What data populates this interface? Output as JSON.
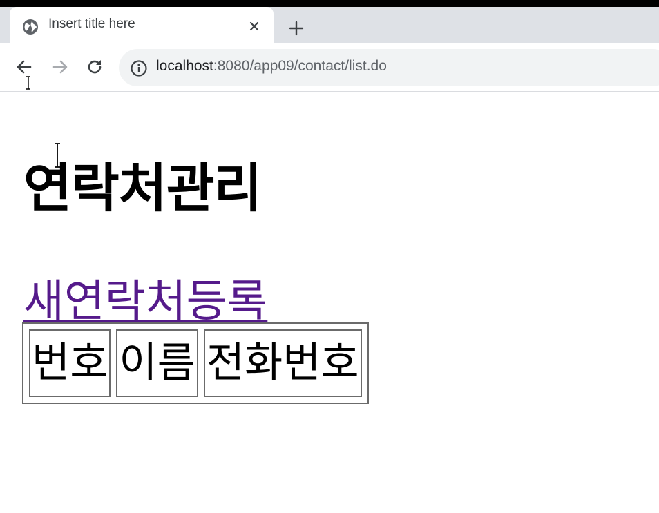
{
  "browser": {
    "tab": {
      "title": "Insert title here",
      "favicon": "globe-icon"
    },
    "address_bar": {
      "host": "localhost",
      "rest": ":8080/app09/contact/list.do"
    },
    "icons": {
      "back": "arrow-left-icon",
      "forward": "arrow-right-icon",
      "reload": "reload-icon",
      "info": "info-icon",
      "close": "close-icon",
      "new_tab": "plus-icon"
    }
  },
  "page": {
    "heading": "연락처관리",
    "new_contact_link": "새연락처등록",
    "link_color": "#551a8b",
    "table": {
      "headers": [
        "번호",
        "이름",
        "전화번호"
      ]
    }
  }
}
